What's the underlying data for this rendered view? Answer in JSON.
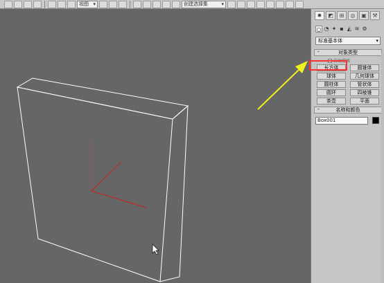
{
  "toolbar": {
    "view_dropdown": "视图",
    "selection_set_placeholder": "创建选择集"
  },
  "command_panel": {
    "tabs": [
      {
        "icon": "sun-create-icon"
      },
      {
        "icon": "modify-icon"
      },
      {
        "icon": "hierarchy-icon"
      },
      {
        "icon": "motion-icon"
      },
      {
        "icon": "display-icon"
      },
      {
        "icon": "utilities-hammer-icon"
      }
    ],
    "categories": [
      {
        "icon": "geometry-sphere-icon",
        "glyph": "○"
      },
      {
        "icon": "shapes-icon",
        "glyph": "◔"
      },
      {
        "icon": "lights-icon",
        "glyph": "✦"
      },
      {
        "icon": "cameras-icon",
        "glyph": "▪"
      },
      {
        "icon": "helpers-icon",
        "glyph": "◭"
      },
      {
        "icon": "spacewarps-icon",
        "glyph": "≋"
      },
      {
        "icon": "systems-icon",
        "glyph": "⚙"
      }
    ],
    "category_dropdown": "标准基本体",
    "object_type": {
      "header": "对象类型",
      "autogrid": "自动栅格",
      "buttons": [
        "长方体",
        "圆锥体",
        "球体",
        "几何球体",
        "圆柱体",
        "管状体",
        "圆环",
        "四棱锥",
        "茶壶",
        "平面"
      ],
      "highlighted": "长方体"
    },
    "name_and_color": {
      "header": "名称和颜色",
      "name_value": "Box001",
      "color": "#000000"
    }
  },
  "viewport": {
    "background": "#666666",
    "wireframe_color": "#ffffff",
    "axis_color": "#cc2222"
  },
  "annotation": {
    "highlight_color": "#ff3030",
    "arrow_color": "#f0f020"
  }
}
